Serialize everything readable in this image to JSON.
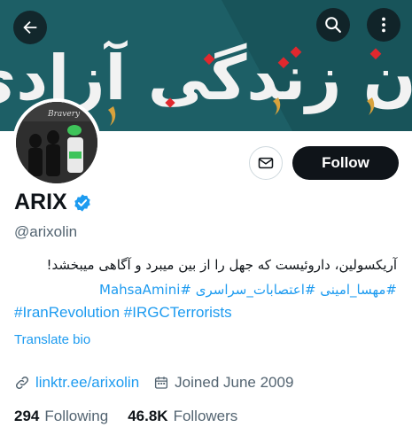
{
  "banner": {
    "slogan": "زن زندگی آزادی",
    "colors": {
      "background": "#1d5f66",
      "text": "#f2f2f2",
      "accent": "#e0282e",
      "gold": "#d8a23c"
    }
  },
  "top_bar": {
    "back_icon": "arrow-left-icon",
    "search_icon": "search-icon",
    "more_icon": "more-vertical-icon"
  },
  "avatar": {
    "caption": "Bravery"
  },
  "actions": {
    "message_icon": "envelope-icon",
    "follow_label": "Follow"
  },
  "profile": {
    "display_name": "ARIX",
    "verified_icon": "verified-badge-icon",
    "handle": "@arixolin",
    "bio_line1": "آریکسولین، داروئیست که جهل را از بین میبرد و آگاهی میبخشد!",
    "bio_line2": "#مهسا_امینی #اعتصابات_سراسری #MahsaAmini",
    "bio_line3": "#IranRevolution #IRGCTerrorists",
    "translate_label": "Translate bio",
    "link_icon": "link-icon",
    "website": "linktr.ee/arixolin",
    "calendar_icon": "calendar-icon",
    "joined": "Joined June 2009"
  },
  "stats": {
    "following_count": "294",
    "following_label": "Following",
    "followers_count": "46.8K",
    "followers_label": "Followers"
  },
  "theme": {
    "accent": "#1d9bf0",
    "text": "#0f1419",
    "secondary": "#536471"
  }
}
